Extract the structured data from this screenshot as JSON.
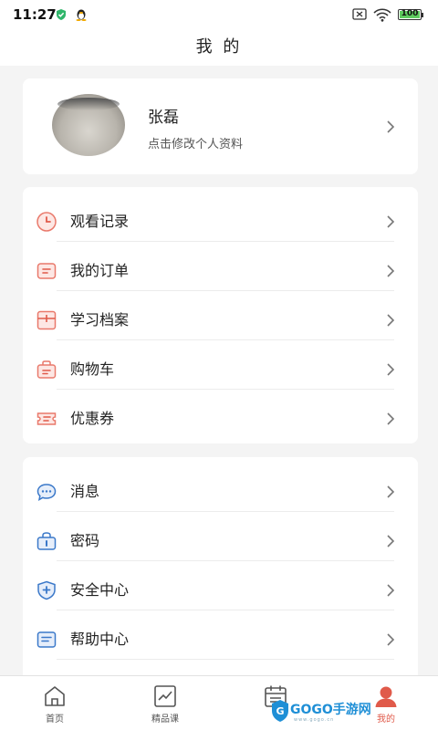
{
  "status_bar": {
    "time": "11:27",
    "battery": "100",
    "battery_level": 1.0
  },
  "header": {
    "title": "我 的"
  },
  "profile": {
    "name": "张磊",
    "subtitle": "点击修改个人资料"
  },
  "menu_group_1": [
    {
      "label": "观看记录",
      "icon": "clock-icon"
    },
    {
      "label": "我的订单",
      "icon": "order-icon"
    },
    {
      "label": "学习档案",
      "icon": "archive-icon"
    },
    {
      "label": "购物车",
      "icon": "cart-bag-icon"
    },
    {
      "label": "优惠券",
      "icon": "coupon-icon"
    }
  ],
  "menu_group_2": [
    {
      "label": "消息",
      "icon": "message-icon"
    },
    {
      "label": "密码",
      "icon": "lock-icon"
    },
    {
      "label": "安全中心",
      "icon": "shield-icon"
    },
    {
      "label": "帮助中心",
      "icon": "help-icon"
    }
  ],
  "tabs": [
    {
      "label": "首页",
      "icon": "home-icon",
      "active": false
    },
    {
      "label": "精品课",
      "icon": "chart-icon",
      "active": false
    },
    {
      "label": "",
      "icon": "calendar-icon",
      "active": false
    },
    {
      "label": "我的",
      "icon": "user-icon",
      "active": true
    }
  ],
  "watermark": {
    "text": "GOGO手游网",
    "url": "www.gogo.cn"
  },
  "colors": {
    "accent": "#e05a4a",
    "blue_icon": "#3a78c9",
    "background": "#f4f4f4"
  }
}
